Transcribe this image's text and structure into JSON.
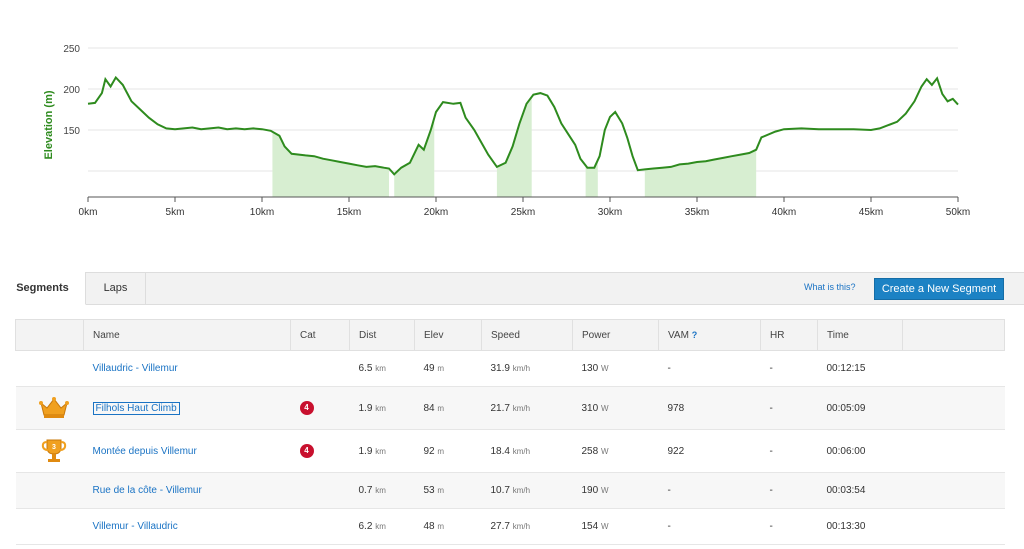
{
  "chart_data": {
    "type": "area",
    "ylabel": "Elevation (m)",
    "xlabel": "",
    "xlim": [
      0,
      50
    ],
    "ylim": [
      100,
      255
    ],
    "y_ticks": [
      "250",
      "200",
      "150"
    ],
    "x_ticks": [
      "0km",
      "5km",
      "10km",
      "15km",
      "20km",
      "25km",
      "30km",
      "35km",
      "40km",
      "45km",
      "50km"
    ],
    "grid": "horizontal",
    "line_color": "#2e8b1e",
    "fill_color": "#d7eed1",
    "profile": [
      [
        0,
        182
      ],
      [
        0.4,
        183
      ],
      [
        0.8,
        195
      ],
      [
        1.0,
        212
      ],
      [
        1.3,
        203
      ],
      [
        1.6,
        214
      ],
      [
        2.0,
        205
      ],
      [
        2.5,
        185
      ],
      [
        3.0,
        175
      ],
      [
        3.5,
        165
      ],
      [
        4.0,
        157
      ],
      [
        4.5,
        152
      ],
      [
        5,
        151
      ],
      [
        5.5,
        152
      ],
      [
        6,
        153
      ],
      [
        6.5,
        151
      ],
      [
        7,
        152
      ],
      [
        7.5,
        153
      ],
      [
        8,
        151
      ],
      [
        8.5,
        152
      ],
      [
        9,
        151
      ],
      [
        9.5,
        152
      ],
      [
        10,
        151
      ],
      [
        10.5,
        149
      ],
      [
        11,
        143
      ],
      [
        11.3,
        130
      ],
      [
        11.7,
        121
      ],
      [
        12.5,
        119
      ],
      [
        13,
        118
      ],
      [
        13.5,
        115
      ],
      [
        14,
        113
      ],
      [
        14.5,
        111
      ],
      [
        15,
        109
      ],
      [
        15.5,
        107
      ],
      [
        16,
        105
      ],
      [
        16.5,
        106
      ],
      [
        17,
        104
      ],
      [
        17.3,
        103
      ],
      [
        17.6,
        96
      ],
      [
        18,
        104
      ],
      [
        18.5,
        110
      ],
      [
        19,
        132
      ],
      [
        19.3,
        126
      ],
      [
        19.7,
        150
      ],
      [
        20,
        172
      ],
      [
        20.4,
        184
      ],
      [
        21,
        182
      ],
      [
        21.4,
        183
      ],
      [
        21.7,
        165
      ],
      [
        22.2,
        150
      ],
      [
        22.6,
        135
      ],
      [
        23,
        120
      ],
      [
        23.5,
        105
      ],
      [
        24,
        110
      ],
      [
        24.4,
        130
      ],
      [
        24.8,
        158
      ],
      [
        25.2,
        182
      ],
      [
        25.6,
        193
      ],
      [
        26,
        195
      ],
      [
        26.4,
        192
      ],
      [
        26.8,
        178
      ],
      [
        27.2,
        158
      ],
      [
        27.6,
        145
      ],
      [
        28,
        132
      ],
      [
        28.3,
        115
      ],
      [
        28.7,
        104
      ],
      [
        29.1,
        104
      ],
      [
        29.4,
        118
      ],
      [
        29.7,
        150
      ],
      [
        30,
        166
      ],
      [
        30.3,
        172
      ],
      [
        30.7,
        158
      ],
      [
        31,
        140
      ],
      [
        31.3,
        118
      ],
      [
        31.6,
        101
      ],
      [
        32,
        102
      ],
      [
        32.5,
        103
      ],
      [
        33,
        104
      ],
      [
        33.5,
        105
      ],
      [
        34,
        108
      ],
      [
        34.5,
        109
      ],
      [
        35,
        111
      ],
      [
        35.5,
        112
      ],
      [
        36,
        114
      ],
      [
        36.5,
        116
      ],
      [
        37,
        118
      ],
      [
        37.5,
        120
      ],
      [
        38,
        122
      ],
      [
        38.4,
        126
      ],
      [
        38.7,
        141
      ],
      [
        39.5,
        148
      ],
      [
        40,
        151
      ],
      [
        41,
        152
      ],
      [
        42,
        151
      ],
      [
        43,
        151
      ],
      [
        44,
        151
      ],
      [
        45,
        150
      ],
      [
        45.5,
        152
      ],
      [
        46,
        156
      ],
      [
        46.5,
        160
      ],
      [
        47,
        170
      ],
      [
        47.5,
        185
      ],
      [
        47.9,
        203
      ],
      [
        48.2,
        212
      ],
      [
        48.5,
        205
      ],
      [
        48.8,
        213
      ],
      [
        49.1,
        194
      ],
      [
        49.4,
        185
      ],
      [
        49.7,
        188
      ],
      [
        50,
        181
      ]
    ],
    "shaded_climbs": [
      [
        10.6,
        17.3
      ],
      [
        17.6,
        19.9
      ],
      [
        23.5,
        25.5
      ],
      [
        28.6,
        29.3
      ],
      [
        32.0,
        38.4
      ]
    ]
  },
  "tabs": {
    "segments": "Segments",
    "laps": "Laps"
  },
  "whatis": "What is this?",
  "create_button": "Create a New Segment",
  "table": {
    "headers": {
      "name": "Name",
      "cat": "Cat",
      "dist": "Dist",
      "elev": "Elev",
      "speed": "Speed",
      "power": "Power",
      "vam": "VAM",
      "vam_help": "?",
      "hr": "HR",
      "time": "Time"
    },
    "rows": [
      {
        "name": "Villaudric - Villemur",
        "cat": "",
        "dist": "6.5",
        "dist_unit": "km",
        "elev": "49",
        "elev_unit": "m",
        "speed": "31.9",
        "speed_unit": "km/h",
        "power": "130",
        "power_unit": "W",
        "vam": "-",
        "hr": "-",
        "time": "00:12:15",
        "award": ""
      },
      {
        "name": "Filhols Haut Climb",
        "cat": "4",
        "dist": "1.9",
        "dist_unit": "km",
        "elev": "84",
        "elev_unit": "m",
        "speed": "21.7",
        "speed_unit": "km/h",
        "power": "310",
        "power_unit": "W",
        "vam": "978",
        "hr": "-",
        "time": "00:05:09",
        "award": "crown-icon"
      },
      {
        "name": "Montée depuis Villemur",
        "cat": "4",
        "dist": "1.9",
        "dist_unit": "km",
        "elev": "92",
        "elev_unit": "m",
        "speed": "18.4",
        "speed_unit": "km/h",
        "power": "258",
        "power_unit": "W",
        "vam": "922",
        "hr": "-",
        "time": "00:06:00",
        "award": "trophy-icon",
        "award_rank": "3"
      },
      {
        "name": "Rue de la côte - Villemur",
        "cat": "",
        "dist": "0.7",
        "dist_unit": "km",
        "elev": "53",
        "elev_unit": "m",
        "speed": "10.7",
        "speed_unit": "km/h",
        "power": "190",
        "power_unit": "W",
        "vam": "-",
        "hr": "-",
        "time": "00:03:54",
        "award": ""
      },
      {
        "name": "Villemur - Villaudric",
        "cat": "",
        "dist": "6.2",
        "dist_unit": "km",
        "elev": "48",
        "elev_unit": "m",
        "speed": "27.7",
        "speed_unit": "km/h",
        "power": "154",
        "power_unit": "W",
        "vam": "-",
        "hr": "-",
        "time": "00:13:30",
        "award": ""
      }
    ]
  }
}
